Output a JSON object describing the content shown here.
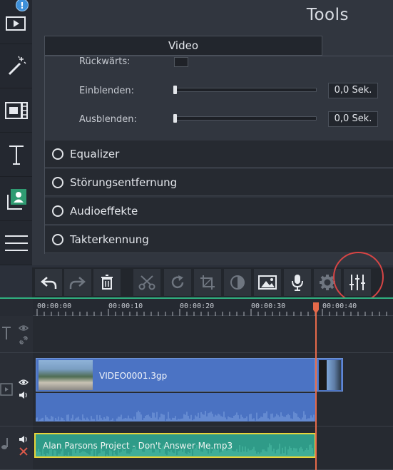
{
  "panel": {
    "title": "Tools",
    "tab": "Video",
    "rows": [
      {
        "label": "Rückwärts:"
      },
      {
        "label": "Einblenden:",
        "value": "0,0 Sek.",
        "level": 0
      },
      {
        "label": "Ausblenden:",
        "value": "0,0 Sek.",
        "level": 0
      }
    ],
    "sections": [
      "Equalizer",
      "Störungsentfernung",
      "Audioeffekte",
      "Takterkennung"
    ]
  },
  "sidebar": {
    "badge": "!",
    "items": [
      "import-icon",
      "magic-wand-icon",
      "filter-icon",
      "text-icon",
      "user-icon",
      "menu-icon"
    ]
  },
  "toolbar": {
    "buttons": [
      "undo-icon",
      "redo-icon",
      "trash-icon",
      "scissors-icon",
      "rotate-icon",
      "crop-icon",
      "color-icon",
      "image-icon",
      "microphone-icon",
      "gear-icon",
      "equalizer-icon"
    ]
  },
  "timeline": {
    "ticks": [
      "00:00:00",
      "00:00:10",
      "00:00:20",
      "00:00:30",
      "00:00:40"
    ],
    "video_clip": "VIDEO0001.3gp",
    "audio_clip": "Alan Parsons Project - Don't Answer Me.mp3"
  },
  "colors": {
    "accent": "#2fb07f",
    "playhead": "#e66a4a",
    "video_clip": "#4b73c4",
    "audio_clip": "#2f9b88",
    "highlight": "#d64545"
  }
}
